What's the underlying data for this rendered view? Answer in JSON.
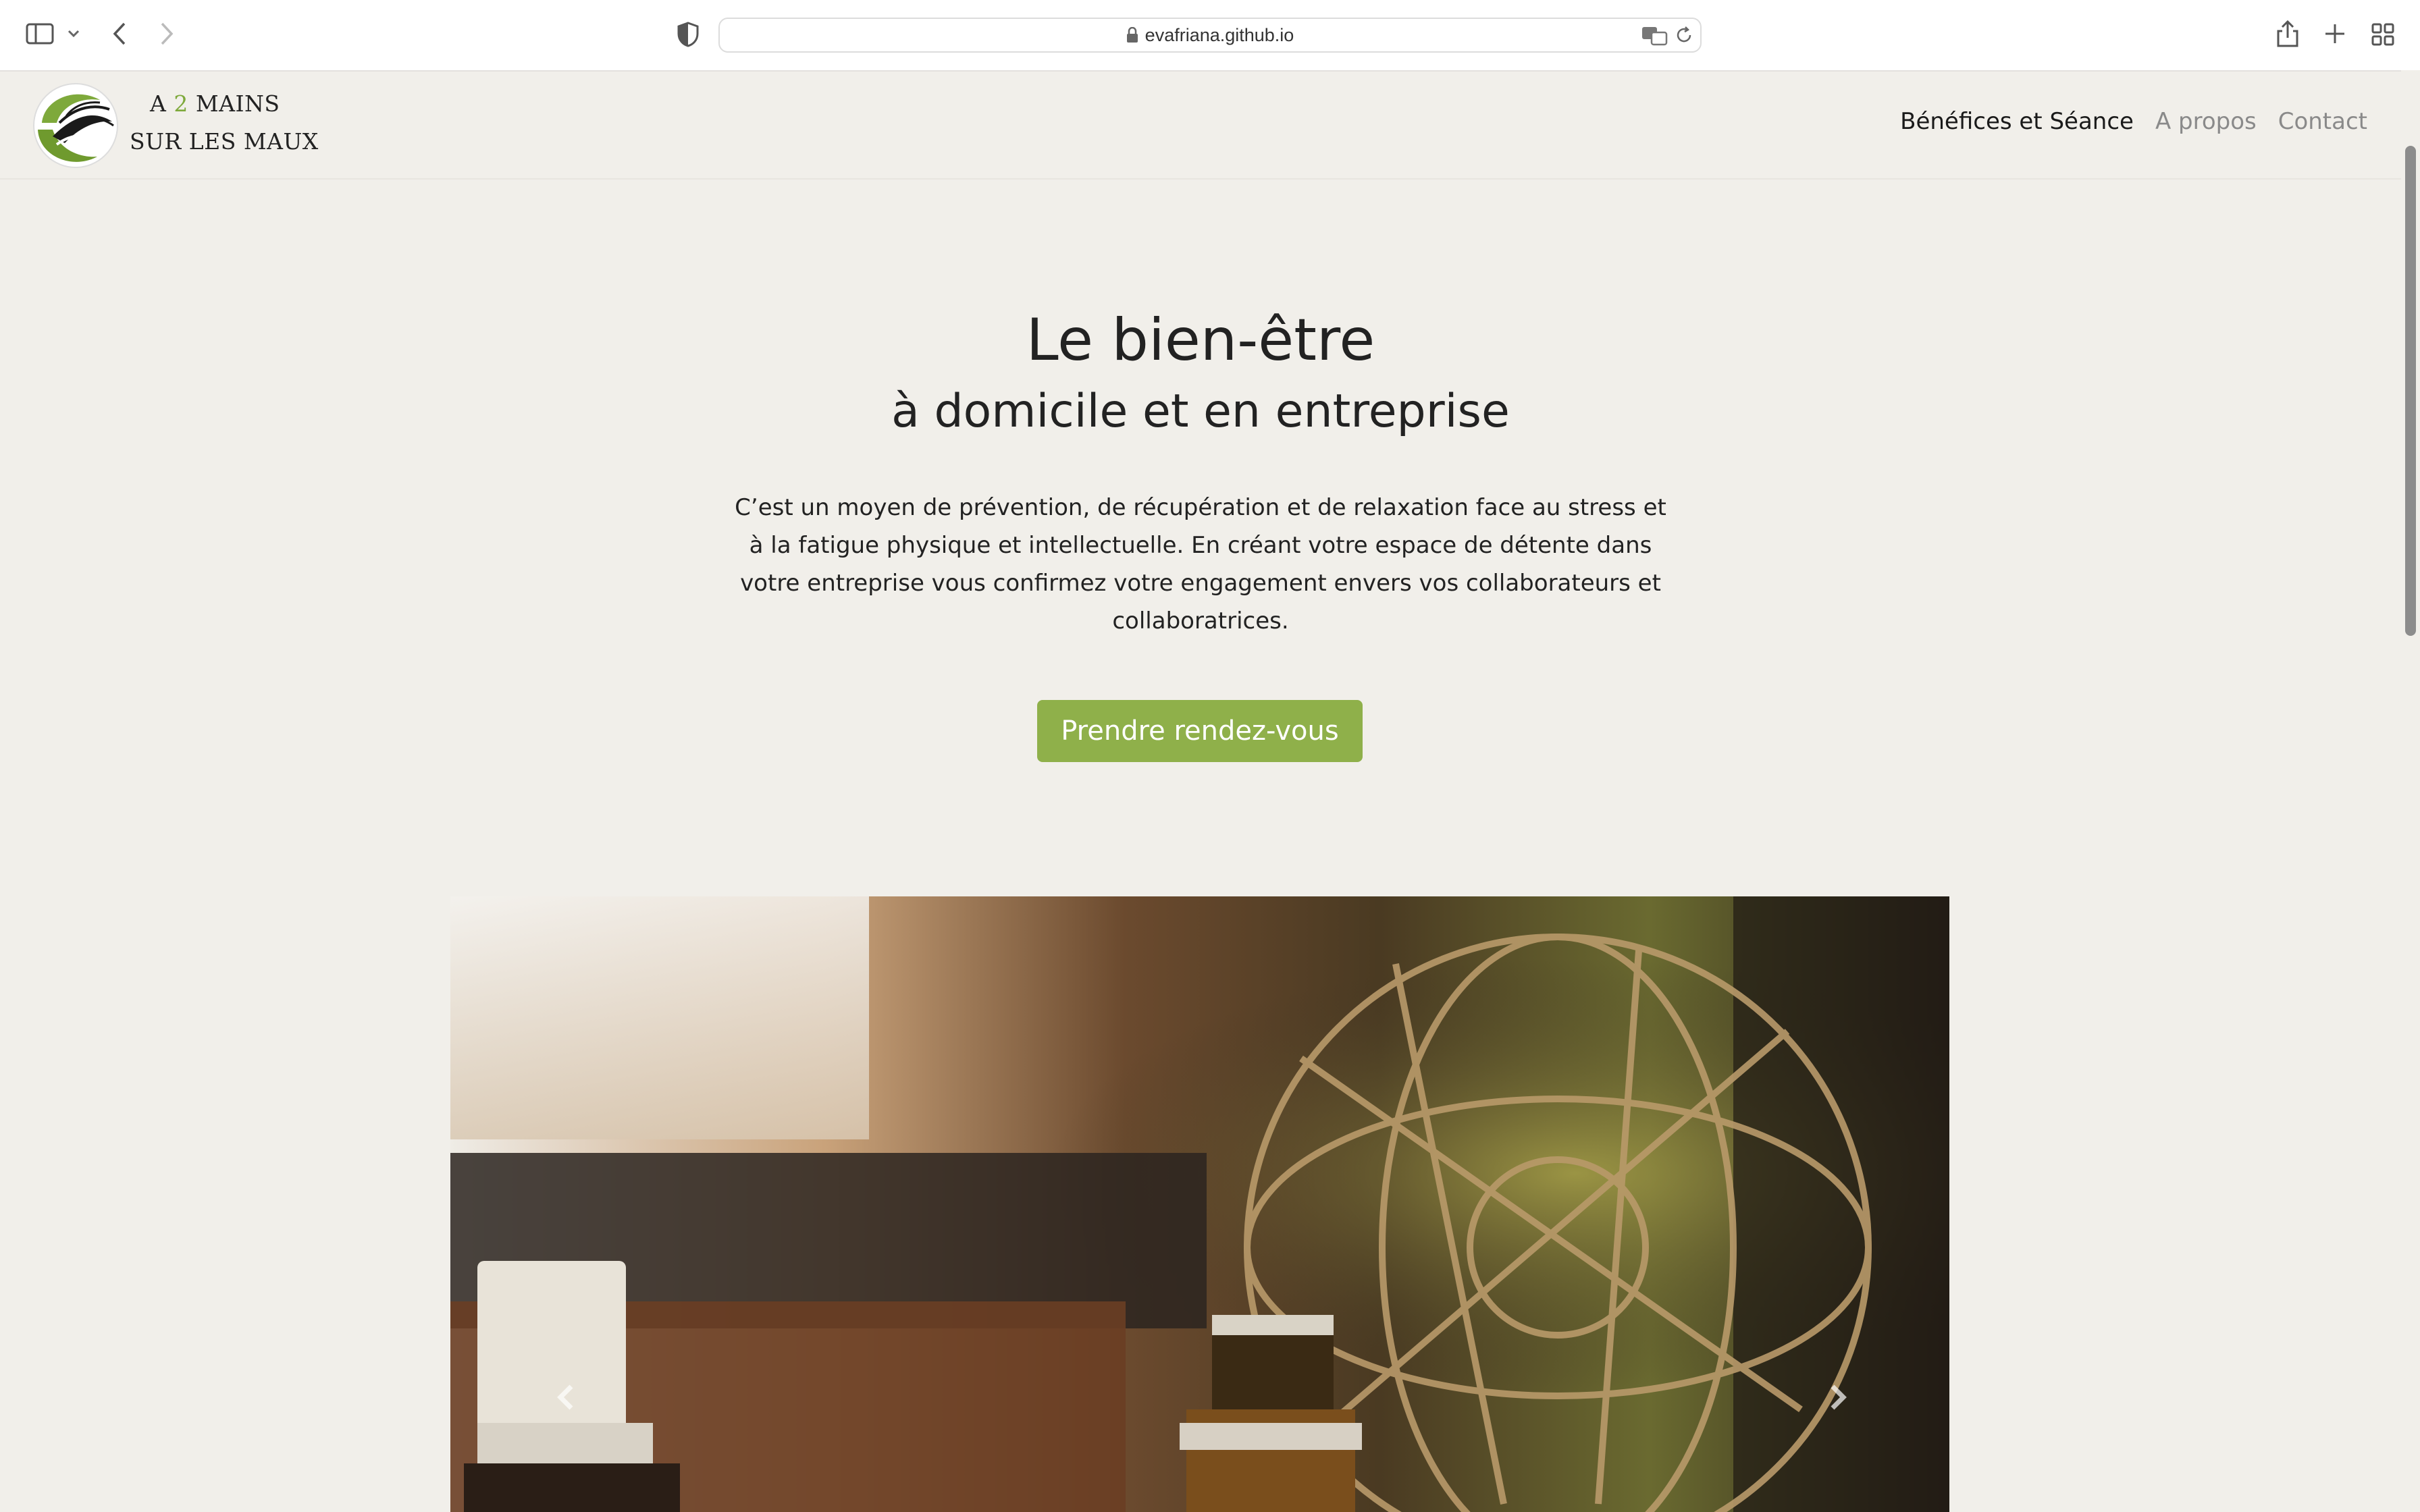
{
  "browser": {
    "url": "evafriana.github.io",
    "icons": [
      "sidebar-icon",
      "chevron-down-icon",
      "back-icon",
      "forward-icon",
      "privacy-shield-icon",
      "lock-icon",
      "translate-icon",
      "reload-icon",
      "share-icon",
      "new-tab-icon",
      "tab-overview-icon"
    ]
  },
  "site": {
    "logo_line1_a": "A ",
    "logo_line1_num": "2",
    "logo_line1_b": " MAINS",
    "logo_line2": "SUR LES MAUX",
    "nav": {
      "benefits": "Bénéfices et Séance",
      "about": "A propos",
      "contact": "Contact"
    }
  },
  "hero": {
    "title": "Le bien-être",
    "subtitle": "à domicile et en entreprise",
    "paragraph": "C’est un moyen de prévention, de récupération et de relaxation face au stress et à la fatigue physique et intellectuelle. En créant votre espace de détente dans votre entreprise vous confirmez votre engagement envers vos collaborateurs et collaboratrices.",
    "cta": "Prendre rendez-vous"
  },
  "colors": {
    "accent_green": "#8fb04a",
    "page_background": "#f1efea"
  }
}
